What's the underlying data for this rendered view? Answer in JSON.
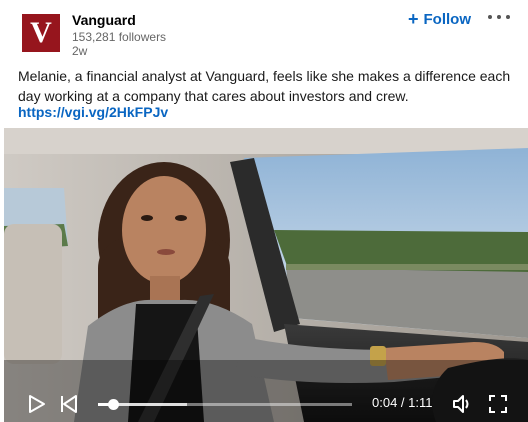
{
  "header": {
    "company_name": "Vanguard",
    "logo_letter": "V",
    "followers": "153,281 followers",
    "time": "2w",
    "follow_label": "Follow",
    "follow_plus": "+"
  },
  "post": {
    "text": "Melanie, a financial analyst at Vanguard, feels like she makes a difference each day working at a company that cares about investors and crew.",
    "link": "https://vgi.vg/2HkFPJv"
  },
  "video": {
    "current_time": "0:04",
    "separator": " / ",
    "duration": "1:11",
    "progress_fraction": 0.06,
    "buffered_fraction": 0.35,
    "icons": [
      "play-icon",
      "previous-icon",
      "volume-icon",
      "fullscreen-icon"
    ]
  },
  "colors": {
    "brand": "#96151d",
    "link": "#0a66c2",
    "muted": "#666666"
  }
}
